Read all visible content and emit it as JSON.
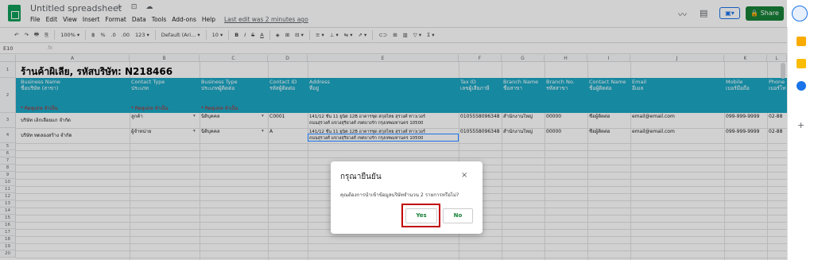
{
  "titlebar": {
    "doc_title": "Untitled spreadsheet",
    "title_icons": "☆ ⊡ ☁",
    "menus": [
      "File",
      "Edit",
      "View",
      "Insert",
      "Format",
      "Data",
      "Tools",
      "Add-ons",
      "Help"
    ],
    "last_edit": "Last edit was 2 minutes ago",
    "share_label": "Share",
    "present_label": "▣▾"
  },
  "toolbar": {
    "items": [
      "↶",
      "↷",
      "🖶",
      "⎘",
      "100% ▾",
      "฿",
      "%",
      ".0",
      ".00",
      "123 ▾",
      "Default (Ari... ▾",
      "10 ▾",
      "B",
      "I",
      "S",
      "A",
      "◈",
      "⊞",
      "⊟ ▾",
      "≡ ▾",
      "⊥ ▾",
      "⇆ ▾",
      "⇗ ▾",
      "⊂⊃",
      "⊞",
      "▥",
      "▽ ▾",
      "Σ ▾"
    ]
  },
  "formula": {
    "cellref": "E10",
    "fx": "fx"
  },
  "grid": {
    "columns": [
      "A",
      "B",
      "C",
      "D",
      "E",
      "F",
      "G",
      "H",
      "I",
      "J",
      "K",
      "L"
    ],
    "store_title": "ร้านค้าผิเลีย, รหัสบริษัท: N218466",
    "headers": [
      "Business Name\nชื่อบริษัท (สาขา)",
      "Contact Type\nประเภท",
      "Business Type\nประเภทผู้ติดต่อ",
      "Contact ID\nรหัสผู้ติดต่อ",
      "Address\nที่อยู่",
      "Tax ID\nเลขผู้เสียภาษี",
      "Branch Name\nชื่อสาขา",
      "Branch No.\nรหัสสาขา",
      "Contact Name\nชื่อผู้ติดต่อ",
      "Email\nอีเมล",
      "Mobile\nเบอร์มือถือ",
      "Phone\nเบอร์โท"
    ],
    "required_label": "* Require จำเป็น",
    "rows": [
      {
        "num": "3",
        "name": "บริษัท เล็กเลื้อยแก จำกัด",
        "contact_type": "ลูกค้า",
        "business_type": "นิติบุคคล",
        "contact_id": "C0001",
        "address1": "141/12 ชั้น 11 ยูนิต 12B อาคารชุด สกุลไทย สุรวงศ์ ทาวเวอร์",
        "address2": "ถนนสุรวงศ์ แขวงสุริยวงศ์ เขตบางรัก กรุงเทพมหานคร 10500",
        "tax_id": "0105558096348",
        "branch_name": "สำนักงานใหญ่",
        "branch_no": "00000",
        "contact_name": "ชื่อผู้ติดต่อ",
        "email": "email@email.com",
        "mobile": "099-999-9999",
        "phone": "02-88"
      },
      {
        "num": "4",
        "name": "บริษัท ทดลองสร้าง จำกัด",
        "contact_type": "ผู้จำหน่าย",
        "business_type": "นิติบุคคล",
        "contact_id": "A",
        "address1": "141/12 ชั้น 11 ยูนิต 12B อาคารชุด สกุลไทย สุรวงศ์ ทาวเวอร์",
        "address2": "ถนนสุรวงศ์ แขวงสุริยวงศ์ เขตบางรัก กรุงเทพมหานคร 10500",
        "tax_id": "0105558096348",
        "branch_name": "สำนักงานใหญ่",
        "branch_no": "00000",
        "contact_name": "ชื่อผู้ติดต่อ",
        "email": "email@email.com",
        "mobile": "099-999-9999",
        "phone": "02-88"
      }
    ],
    "empty_rows": [
      "5",
      "6",
      "7",
      "8",
      "9",
      "10",
      "11",
      "12",
      "13",
      "14",
      "15",
      "16",
      "17",
      "18",
      "19",
      "20"
    ]
  },
  "dialog": {
    "title": "กรุณายืนยัน",
    "close": "×",
    "message": "คุณต้องการนำเข้าข้อมูลบริษัทจำนวน 2 รายการหรือไม่?",
    "yes_label": "Yes",
    "no_label": "No"
  },
  "colors": {
    "header_band": "#1ca6c4",
    "share": "#188038",
    "highlight": "#c00000"
  }
}
